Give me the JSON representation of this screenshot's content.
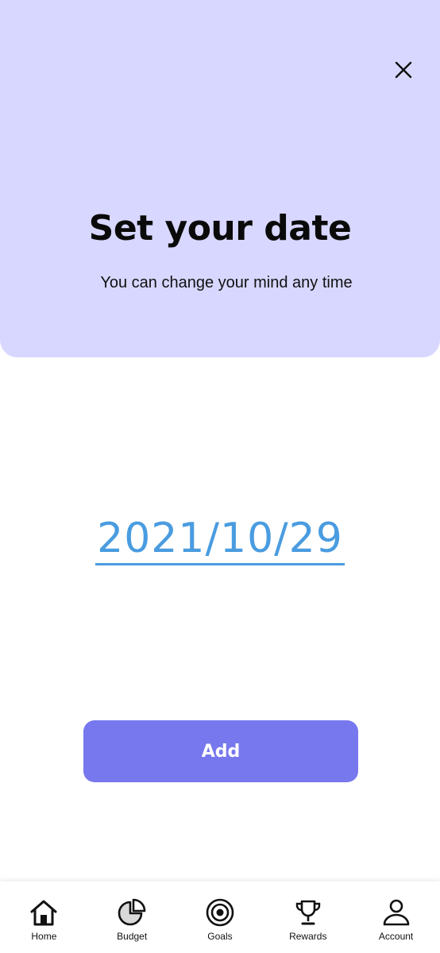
{
  "header": {
    "title": "Set your date",
    "subtitle": "You can change your mind any time",
    "close_icon": "close-icon"
  },
  "date_field": {
    "value": "2021/10/29"
  },
  "actions": {
    "add_label": "Add"
  },
  "bottom_nav": {
    "items": [
      {
        "label": "Home",
        "icon": "home-icon"
      },
      {
        "label": "Budget",
        "icon": "pie-chart-icon"
      },
      {
        "label": "Goals",
        "icon": "target-icon"
      },
      {
        "label": "Rewards",
        "icon": "trophy-icon"
      },
      {
        "label": "Account",
        "icon": "user-icon"
      }
    ]
  },
  "colors": {
    "header_bg": "#d8d7ff",
    "accent": "#7778ee",
    "date_link": "#4a9ce0"
  }
}
